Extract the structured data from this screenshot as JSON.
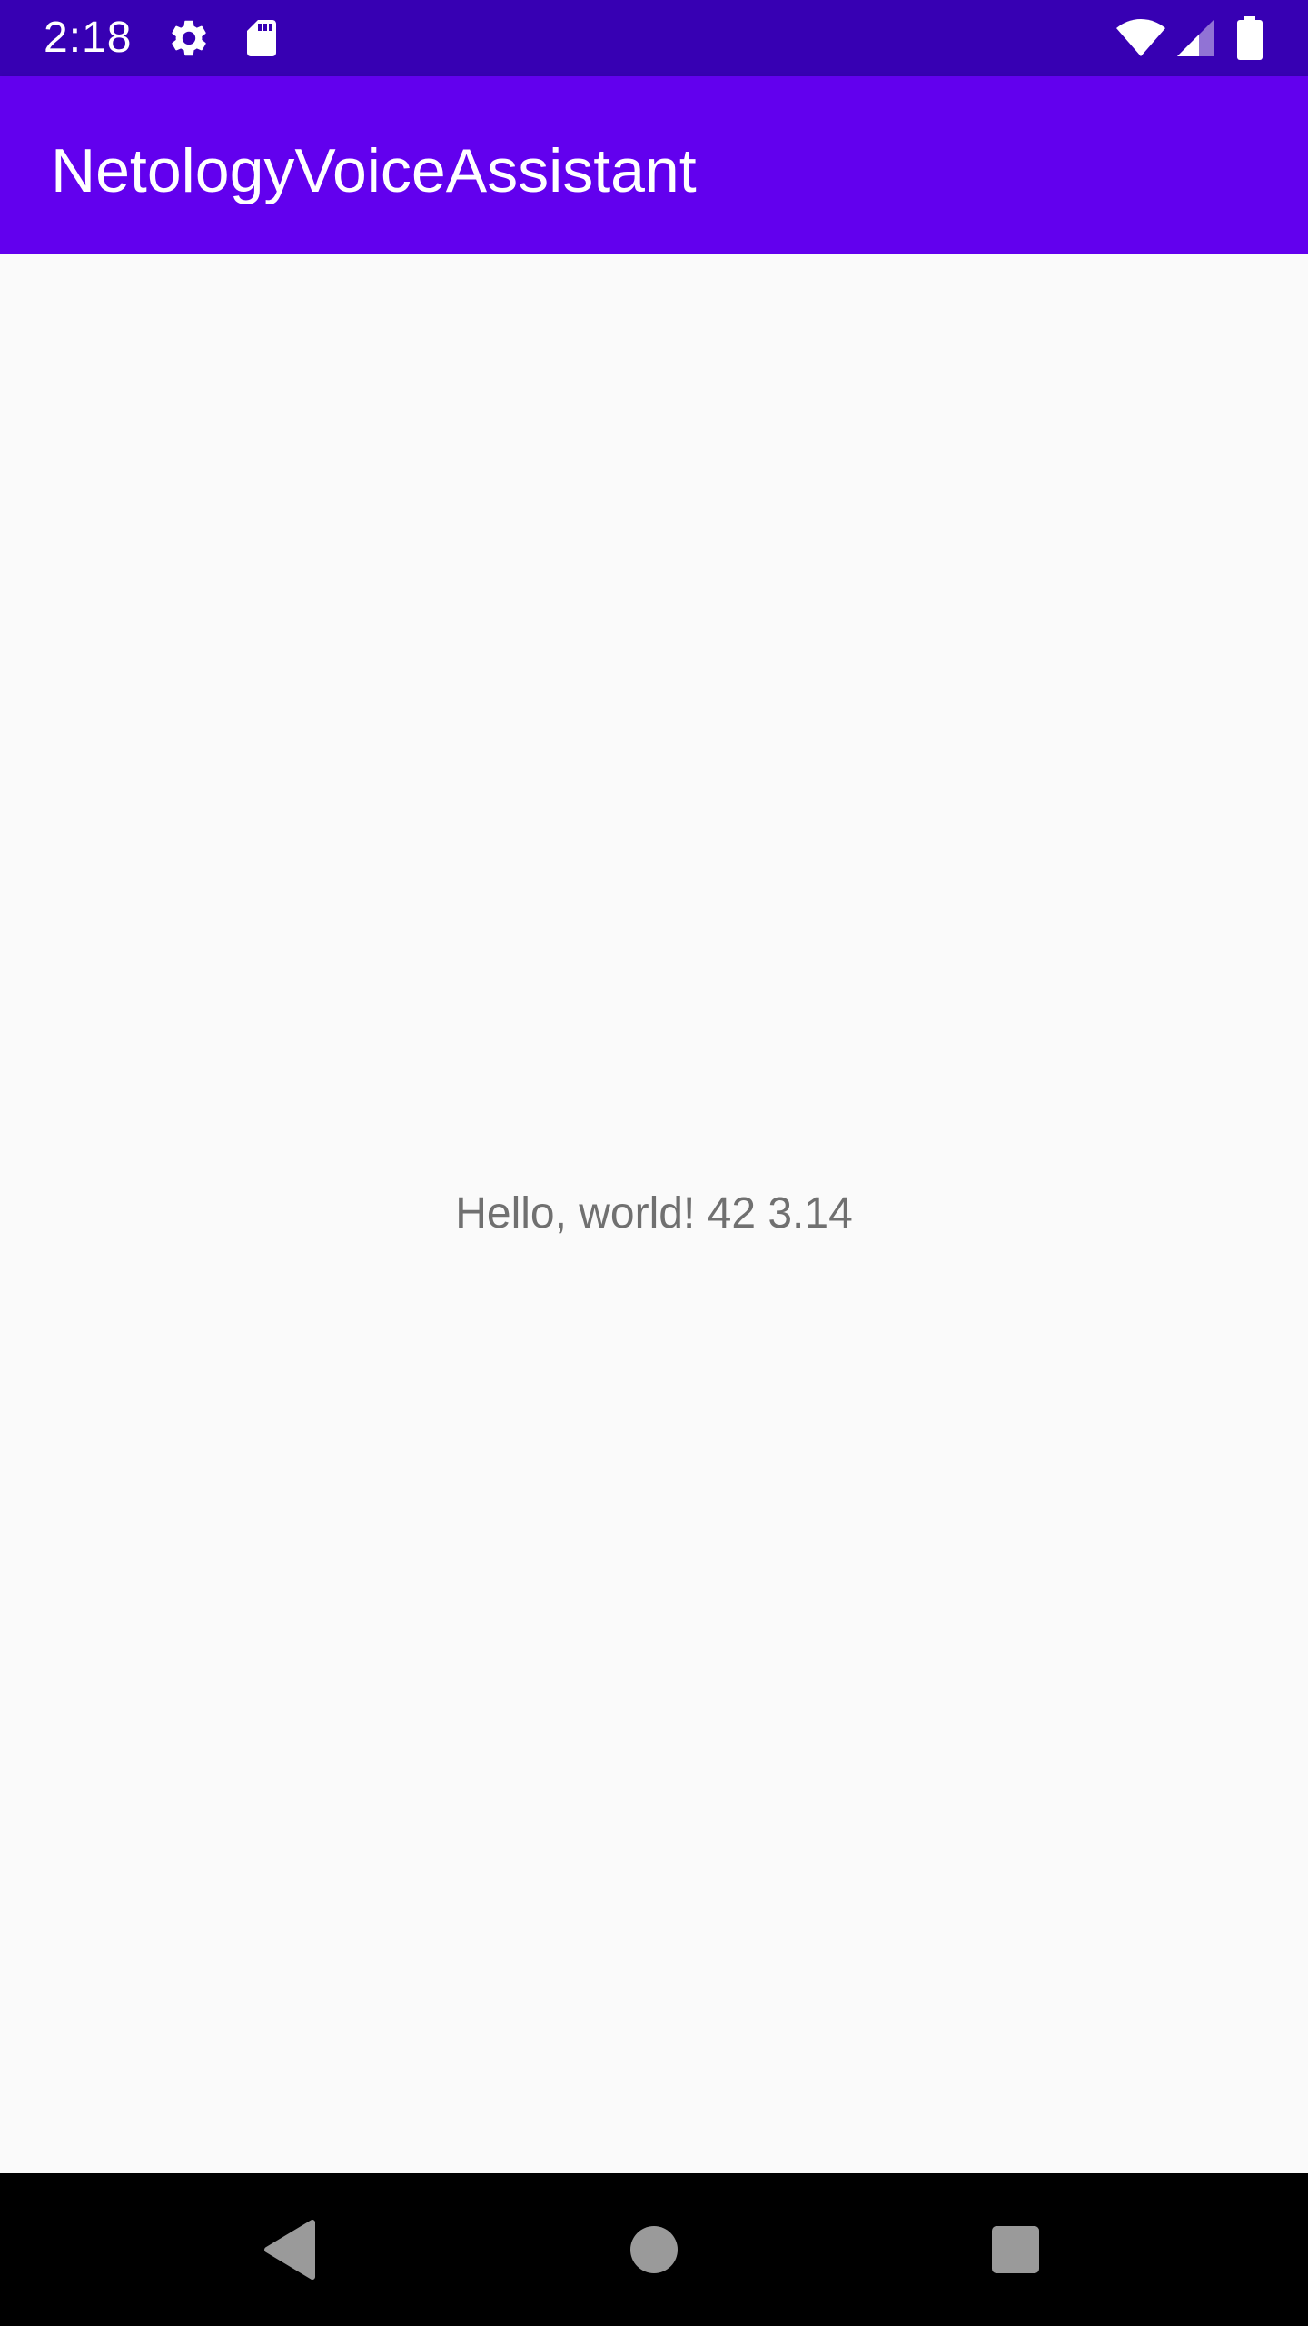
{
  "status_bar": {
    "time": "2:18",
    "icons": [
      "gear-icon",
      "sd-card-icon",
      "wifi-icon",
      "cell-signal-icon",
      "battery-icon"
    ],
    "background_color": "#3700b3"
  },
  "app_bar": {
    "title": "NetologyVoiceAssistant",
    "background_color": "#6200ee"
  },
  "content": {
    "text": "Hello, world! 42 3.14",
    "background_color": "#fafafa"
  },
  "nav_bar": {
    "buttons": [
      "back-icon",
      "home-icon",
      "recents-icon"
    ],
    "background_color": "#000000"
  }
}
